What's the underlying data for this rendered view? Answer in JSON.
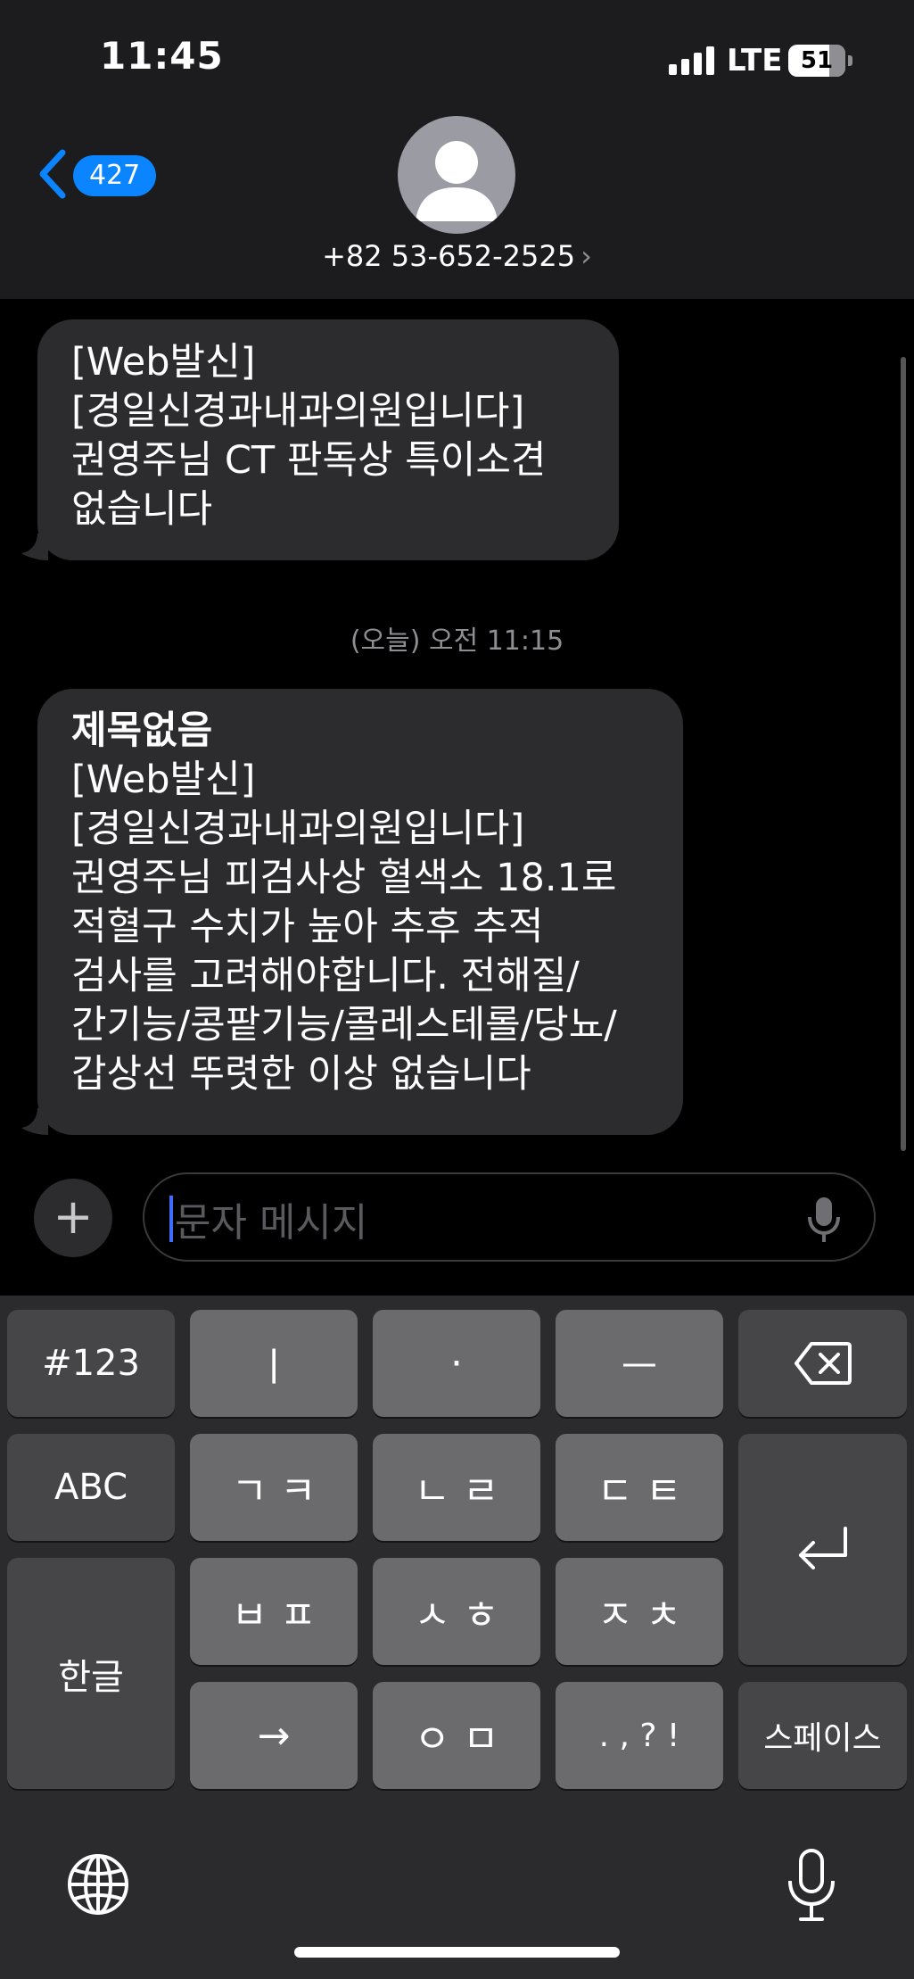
{
  "status": {
    "time": "11:45",
    "network": "LTE",
    "battery": "51"
  },
  "header": {
    "back_count": "427",
    "contact": "+82 53-652-2525",
    "chevron": "›"
  },
  "messages": [
    {
      "lines": [
        "[Web발신]",
        "[경일신경과내과의원입니다]",
        "권영주님 CT 판독상 특이소견",
        "없습니다"
      ]
    },
    {
      "title": "제목없음",
      "lines": [
        "[Web발신]",
        "[경일신경과내과의원입니다]",
        "권영주님 피검사상 혈색소 18.1로",
        "적혈구 수치가 높아 추후 추적",
        "검사를 고려해야합니다. 전해질/",
        "간기능/콩팥기능/콜레스테롤/당뇨/",
        "갑상선 뚜렷한 이상 없습니다"
      ]
    }
  ],
  "timestamp": "(오늘) 오전 11:15",
  "composer": {
    "placeholder": "문자 메시지",
    "plus": "+"
  },
  "keyboard": {
    "row1": [
      "#123",
      "ㅣ",
      "·",
      "ㅡ"
    ],
    "row2": [
      "ABC",
      "ㄱ ㅋ",
      "ㄴ ㄹ",
      "ㄷ ㅌ"
    ],
    "row3": [
      "ㅂ ㅍ",
      "ㅅ ㅎ",
      "ㅈ ㅊ"
    ],
    "row4": [
      "→",
      "ㅇ ㅁ",
      ". , ? !",
      "스페이스"
    ],
    "hangul": "한글"
  },
  "icons": [
    "back-chevron-icon",
    "avatar-icon",
    "mic-icon",
    "delete-icon",
    "return-icon",
    "globe-icon",
    "dictation-icon"
  ]
}
